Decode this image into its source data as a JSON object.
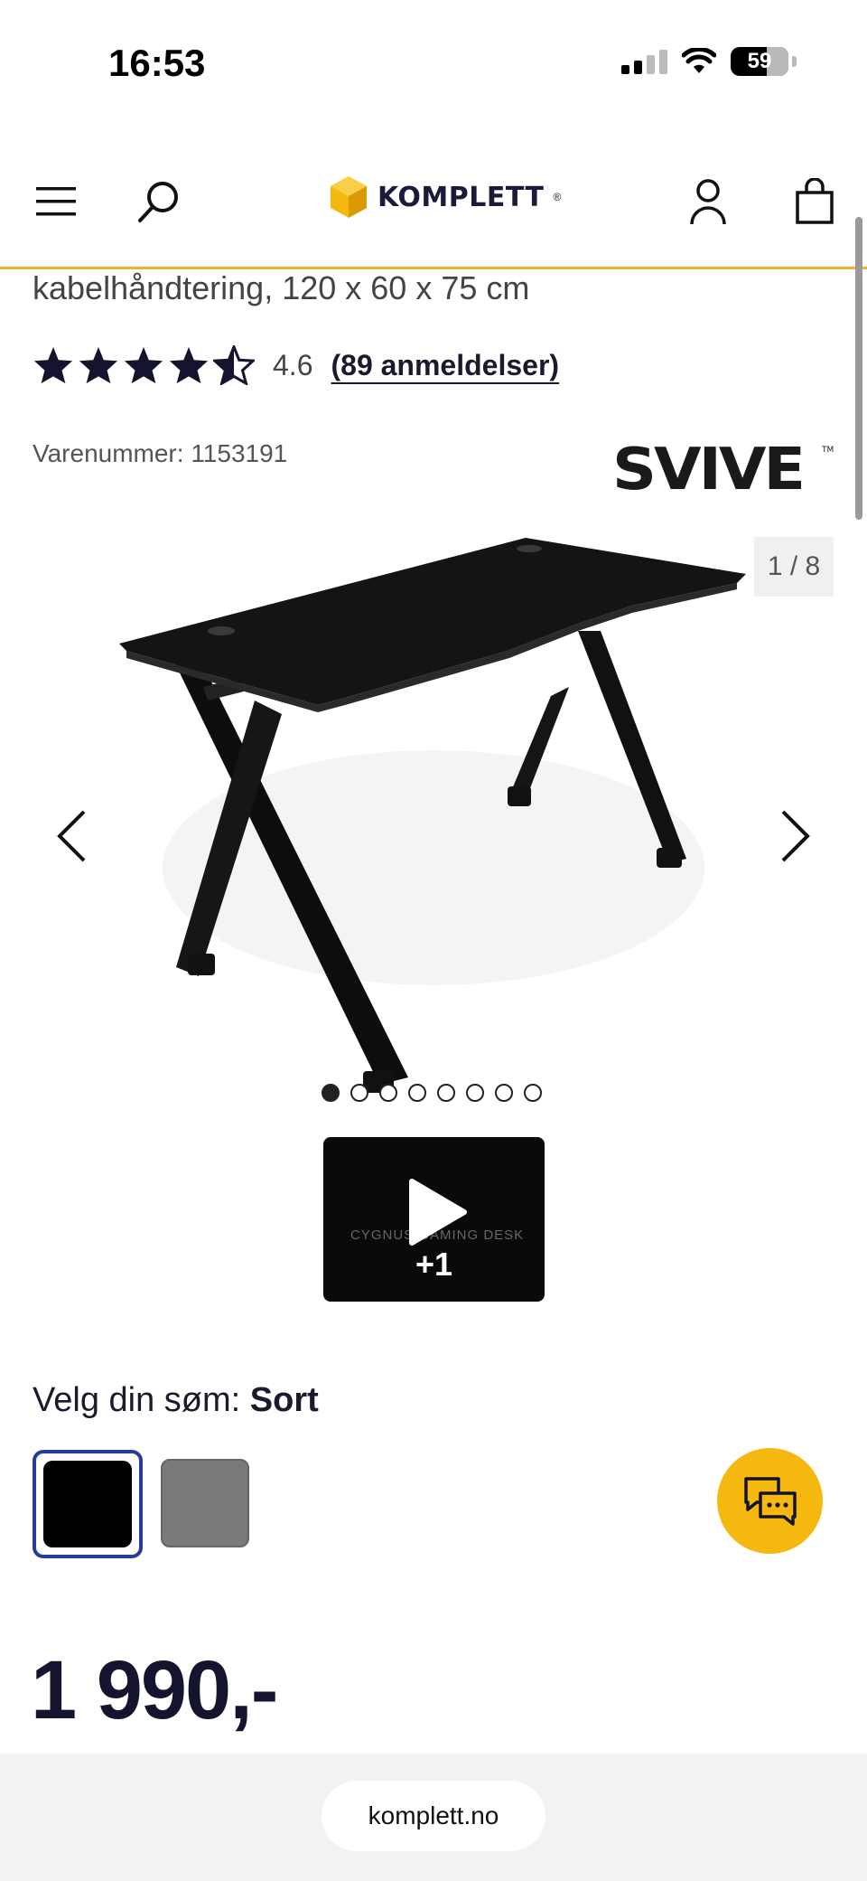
{
  "status_bar": {
    "time": "16:53",
    "battery": "59"
  },
  "header": {
    "logo_text": "KOMPLETT"
  },
  "product": {
    "subtitle": "kabelhåndtering, 120 x 60 x 75 cm",
    "rating_value": "4.6",
    "reviews_link": "(89 anmeldelser)",
    "sku": "Varenummer: 1153191",
    "brand": "SVIVE"
  },
  "gallery": {
    "counter": "1 / 8",
    "dots_total": 8,
    "dot_active": 1,
    "video_more": "+1",
    "video_ghost_text": "CYGNUS GAMING DESK"
  },
  "color_picker": {
    "label": "Velg din søm: ",
    "selected": "Sort",
    "options": [
      {
        "name": "black",
        "color": "#000000"
      },
      {
        "name": "grey",
        "color": "#7a7a7a"
      }
    ]
  },
  "price": "1 990,-",
  "browser": {
    "url": "komplett.no"
  },
  "colors": {
    "accent": "#f0b323",
    "chat": "#f5b80f",
    "selected_border": "#2a3a9a"
  }
}
